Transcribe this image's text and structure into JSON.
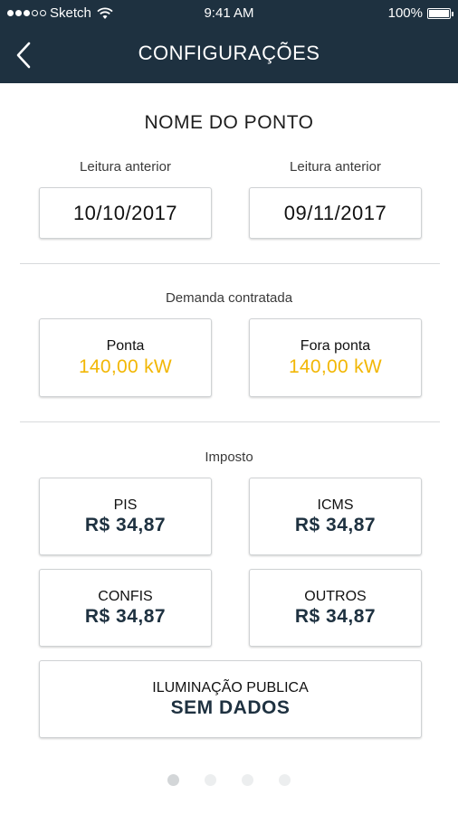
{
  "status_bar": {
    "carrier": "Sketch",
    "time": "9:41 AM",
    "battery": "100%"
  },
  "nav": {
    "title": "CONFIGURAÇÕES",
    "back_icon": "chevron-left-icon"
  },
  "point": {
    "name": "NOME DO PONTO"
  },
  "readings": [
    {
      "label": "Leitura anterior",
      "date": "10/10/2017"
    },
    {
      "label": "Leitura anterior",
      "date": "09/11/2017"
    }
  ],
  "demand": {
    "title": "Demanda contratada",
    "ponta": {
      "label": "Ponta",
      "value": "140,00 kW"
    },
    "fora_ponta": {
      "label": "Fora ponta",
      "value": "140,00 kW"
    }
  },
  "taxes": {
    "title": "Imposto",
    "pis": {
      "label": "PIS",
      "value": "R$ 34,87"
    },
    "icms": {
      "label": "ICMS",
      "value": "R$ 34,87"
    },
    "confis": {
      "label": "CONFIS",
      "value": "R$ 34,87"
    },
    "outros": {
      "label": "OUTROS",
      "value": "R$ 34,87"
    },
    "iluminacao": {
      "label": "ILUMINAÇÃO PUBLICA",
      "value": "SEM DADOS"
    }
  },
  "pager": {
    "pages": 4,
    "active_page": 1
  },
  "colors": {
    "header": "#1e3140",
    "accent": "#f2b705"
  }
}
